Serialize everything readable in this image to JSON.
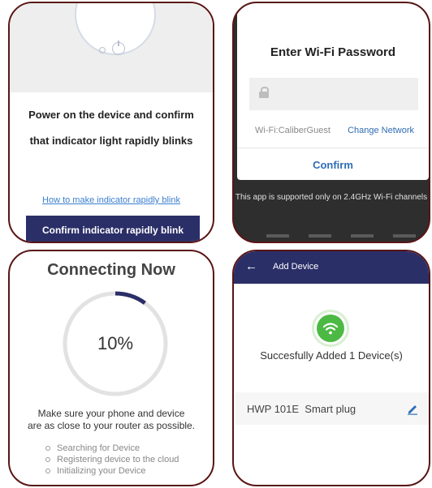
{
  "panel1": {
    "instruction_line1": "Power on the device and confirm",
    "instruction_line2": "that indicator light rapidly blinks",
    "help_link": "How to make indicator rapidly blink",
    "confirm_button": "Confirm indicator rapidly blink"
  },
  "panel2": {
    "dialog_title": "Enter Wi-Fi Password",
    "wifi_label": "Wi-Fi:CaliberGuest",
    "change_network": "Change Network",
    "confirm": "Confirm",
    "support_note": "This app is supported only on 2.4GHz Wi-Fi channels"
  },
  "panel3": {
    "title": "Connecting Now",
    "progress_text": "10%",
    "progress_fraction": 0.1,
    "message_line1": "Make sure your phone and device",
    "message_line2": "are as close to your router as possible.",
    "steps": [
      "Searching for Device",
      "Registering device to the cloud",
      "Initializing your Device"
    ]
  },
  "panel4": {
    "header_title": "Add Device",
    "success_message": "Succesfully Added 1 Device(s)",
    "device_name": "HWP 101E  Smart plug"
  },
  "colors": {
    "accent_navy": "#2b2f68",
    "link_blue": "#2f6db5",
    "success_green": "#4cb944",
    "panel_border": "#5a1515"
  },
  "icons": [
    "power-icon",
    "lock-icon",
    "back-arrow-icon",
    "wifi-icon",
    "pencil-icon"
  ]
}
